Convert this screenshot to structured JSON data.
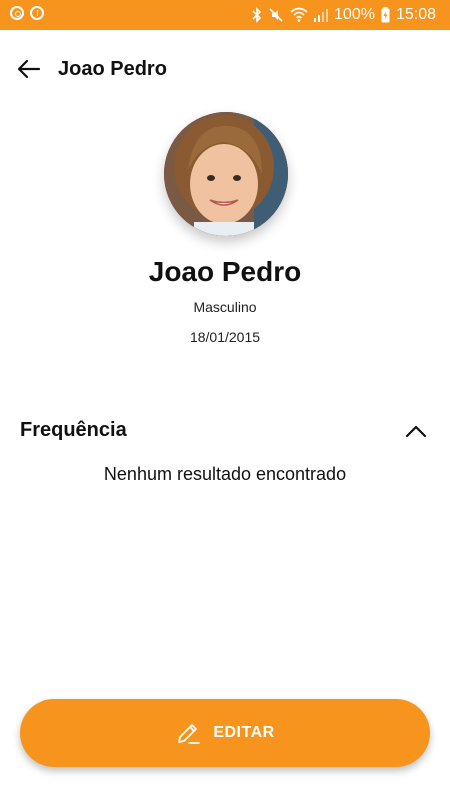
{
  "status_bar": {
    "battery_percent": "100%",
    "time": "15:08",
    "background_color": "#F7941D",
    "icons": [
      "target-icon",
      "info-icon",
      "bluetooth-icon",
      "mute-icon",
      "wifi-icon",
      "signal-icon",
      "battery-charging-icon"
    ]
  },
  "header": {
    "title": "Joao Pedro",
    "back_icon": "arrow-left-icon"
  },
  "profile": {
    "name": "Joao Pedro",
    "gender": "Masculino",
    "birthdate": "18/01/2015"
  },
  "frequency_section": {
    "title": "Frequência",
    "toggle_icon": "chevron-up-icon",
    "empty_message": "Nenhum resultado encontrado"
  },
  "edit_button": {
    "label": "EDITAR",
    "icon": "pencil-icon",
    "color": "#F7941D"
  }
}
